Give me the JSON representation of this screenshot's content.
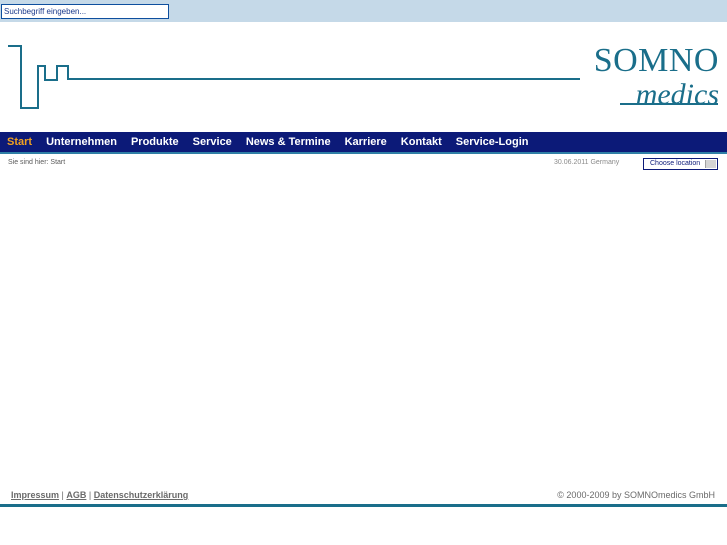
{
  "search": {
    "placeholder": "Suchbegriff eingeben..."
  },
  "logo": {
    "line1": "SOMNO",
    "line2": "medics"
  },
  "nav": {
    "items": [
      {
        "label": "Start",
        "active": true
      },
      {
        "label": "Unternehmen"
      },
      {
        "label": "Produkte"
      },
      {
        "label": "Service"
      },
      {
        "label": "News & Termine"
      },
      {
        "label": "Karriere"
      },
      {
        "label": "Kontakt"
      },
      {
        "label": "Service-Login"
      }
    ]
  },
  "breadcrumb": "Sie sind hier: Start",
  "date_country": "30.06.2011 Germany",
  "location_select": {
    "label": "Choose location"
  },
  "footer": {
    "links": [
      "Impressum",
      "AGB",
      "Datenschutzerklärung"
    ],
    "separator": "|",
    "copyright": "© 2000-2009 by SOMNOmedics GmbH"
  },
  "colors": {
    "nav_background": "#0c1a78",
    "nav_active": "#f0a020",
    "brand_teal": "#1a6e8a",
    "top_bar": "#c5d9e8"
  }
}
